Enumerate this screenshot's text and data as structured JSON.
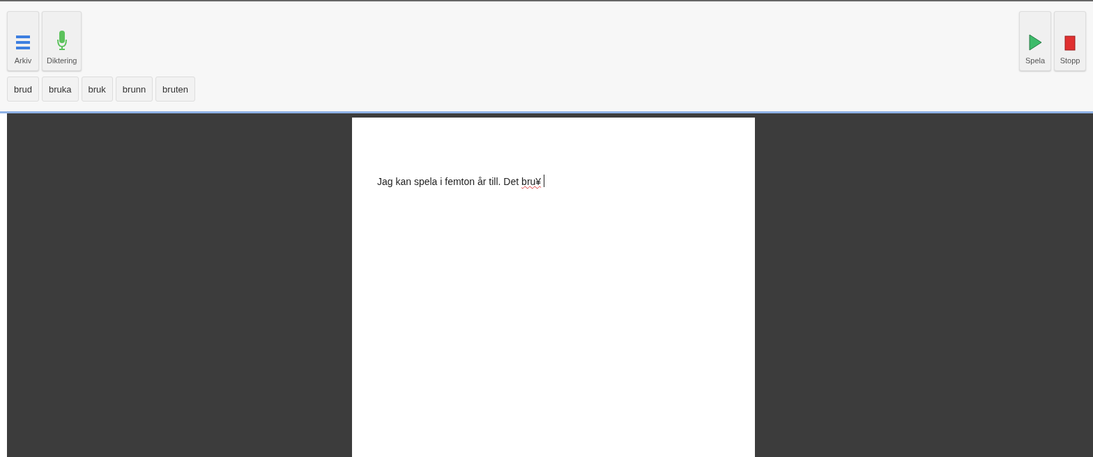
{
  "toolbar": {
    "left_buttons": [
      {
        "kind": "menu",
        "label": "Arkiv"
      },
      {
        "kind": "mic",
        "label": "Diktering"
      }
    ],
    "right_buttons": [
      {
        "kind": "play",
        "label": "Spela"
      },
      {
        "kind": "stop",
        "label": "Stopp"
      }
    ],
    "suggestions": [
      "brud",
      "bruka",
      "bruk",
      "brunn",
      "bruten"
    ]
  },
  "document": {
    "segments": [
      {
        "text": "Jag kan spela i femton år till. Det",
        "misspelled": false
      },
      {
        "text": "bru¥",
        "misspelled": true
      }
    ]
  }
}
